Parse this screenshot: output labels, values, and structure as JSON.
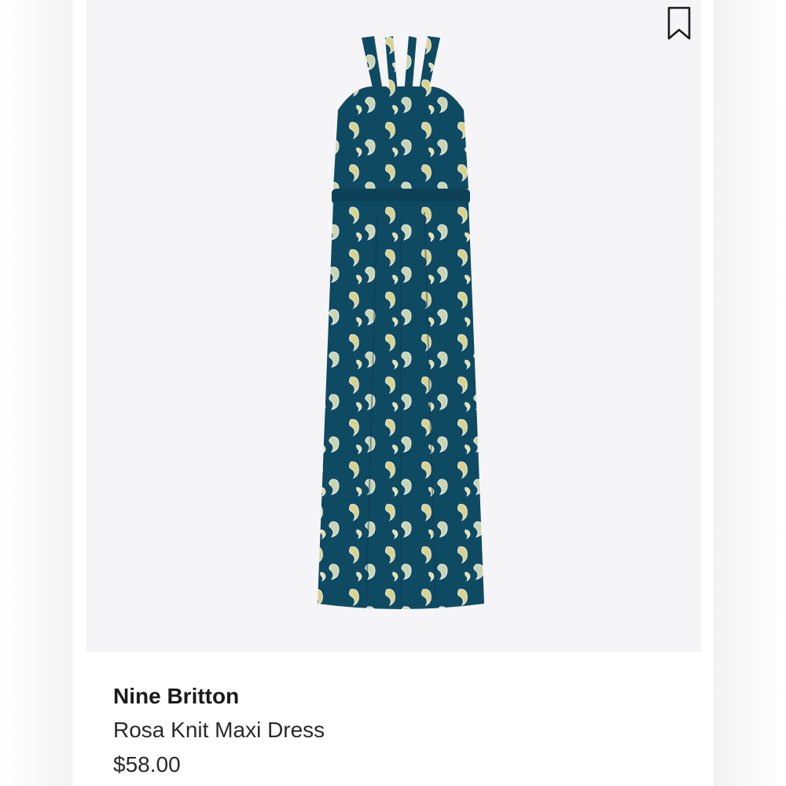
{
  "product": {
    "brand": "Nine Britton",
    "name": "Rosa Knit Maxi Dress",
    "price": "$58.00",
    "image_alt_icon": "dress-image",
    "bookmark_icon": "bookmark-icon"
  },
  "colors": {
    "image_background": "#f5f5f7",
    "dress_primary": "#0f4a63",
    "print_accent": "#d9d38a",
    "text": "#1b1b1b"
  }
}
